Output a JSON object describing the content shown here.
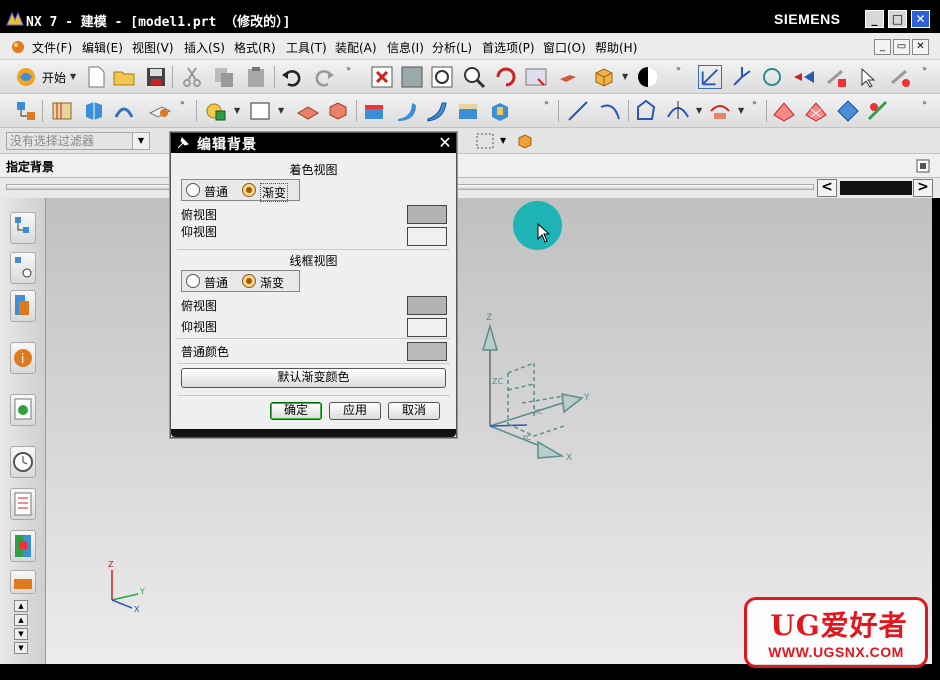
{
  "window": {
    "title": "NX 7 - 建模 - [model1.prt （修改的）]",
    "brand": "SIEMENS",
    "minimize": "_",
    "maximize": "□",
    "close": "✕"
  },
  "menubar": {
    "items": [
      "文件(F)",
      "编辑(E)",
      "视图(V)",
      "插入(S)",
      "格式(R)",
      "工具(T)",
      "装配(A)",
      "信息(I)",
      "分析(L)",
      "首选项(P)",
      "窗口(O)",
      "帮助(H)"
    ],
    "mdi": [
      "_",
      "▭",
      "✕"
    ]
  },
  "toolbar": {
    "start_label": "开始"
  },
  "selection_bar": {
    "filter_placeholder": "没有选择过滤器"
  },
  "prompt": {
    "text": "指定背景"
  },
  "scrollbar": {
    "left": "<",
    "right": ">"
  },
  "dialog": {
    "title": "编辑背景",
    "close": "✕",
    "shaded": {
      "title": "着色视图",
      "options": [
        "普通",
        "渐变"
      ],
      "selected": "渐变",
      "top_label": "俯视图",
      "bottom_label": "仰视图",
      "top_color": "#b3b3b3",
      "bottom_color": "#f0f0f0"
    },
    "wireframe": {
      "title": "线框视图",
      "options": [
        "普通",
        "渐变"
      ],
      "selected": "渐变",
      "top_label": "俯视图",
      "bottom_label": "仰视图",
      "top_color": "#b3b3b3",
      "bottom_color": "#f0f0f0"
    },
    "plain_color_label": "普通颜色",
    "plain_color": "#b9b9b9",
    "default_gradient_button": "默认渐变颜色",
    "ok_button": "确定",
    "apply_button": "应用",
    "cancel_button": "取消"
  },
  "viewport": {
    "csys_labels": {
      "z": "Z",
      "zc": "ZC",
      "y": "Y",
      "x": "X",
      "yc": "YC",
      "xc": "XC"
    },
    "triad_labels": {
      "z": "Z",
      "y": "Y",
      "x": "X"
    }
  },
  "watermark": {
    "main": "UG爱好者",
    "url": "WWW.UGSNX.COM"
  },
  "colors": {
    "graphics_top": "#c0c0c0",
    "graphics_bottom": "#ececec",
    "cursor_halo": "#1eb3b5",
    "watermark_red": "#e1171e",
    "csys_color": "#5d8c8c"
  }
}
